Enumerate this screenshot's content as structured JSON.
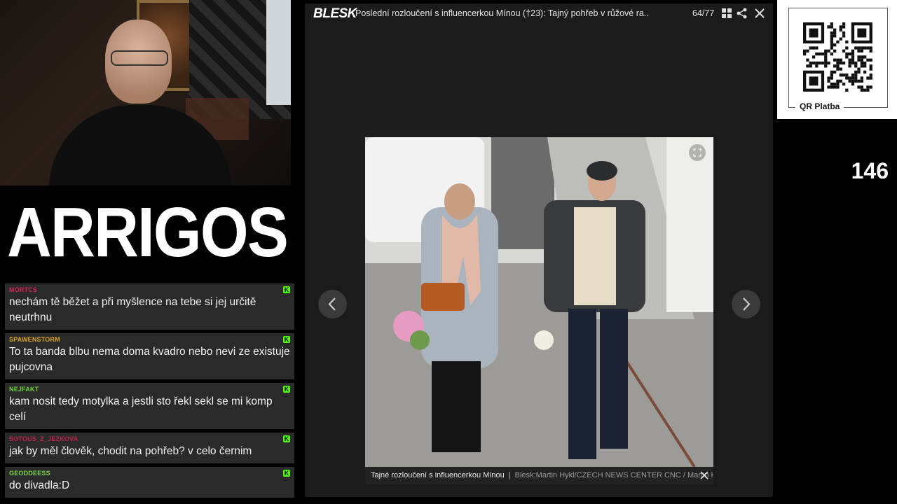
{
  "logo": {
    "text": "ARRIGOS"
  },
  "chat": [
    {
      "user": "MORTCS",
      "color": "#d6284f",
      "text": "nechám tě běžet a při myšlence na tebe si jej určitě neutrhnu"
    },
    {
      "user": "SPAWENSTORM",
      "color": "#d9a62e",
      "text": "To ta banda blbu nema doma kvadro nebo nevi ze existuje pujcovna"
    },
    {
      "user": "NEJFAKT",
      "color": "#6fd13c",
      "text": "kam nosit tedy motylka a jestli sto řekl sekl se mi komp celí"
    },
    {
      "user": "SOTOUS_Z_JEZKOVA",
      "color": "#c2224a",
      "text": "jak by měl člověk, chodit na pohřeb? v celo černim"
    },
    {
      "user": "GEODDEESS",
      "color": "#7fd94a",
      "text": "do divadla:D"
    }
  ],
  "gallery": {
    "brand": "BLESK",
    "title": "Poslední rozloučení s influencerkou Mínou (†23): Tajný pohřeb v růžové ra...",
    "counter": "64/77",
    "caption": "Tajné rozloučení s influencerkou Mínou",
    "credit": "Blesk:Martin Hykl/CZECH NEWS CENTER CNC / Martin Hykl"
  },
  "qr": {
    "label": "QR Platba"
  },
  "viewer_count": "146",
  "icons": {
    "grid": "grid-icon",
    "share": "share-icon",
    "close": "close-icon",
    "prev": "chevron-left-icon",
    "next": "chevron-right-icon",
    "expand": "expand-icon"
  },
  "colors": {
    "kick_green": "#53fc18",
    "chat_bg": "#2a2a2a",
    "gallery_bg": "#1b1b1b"
  }
}
